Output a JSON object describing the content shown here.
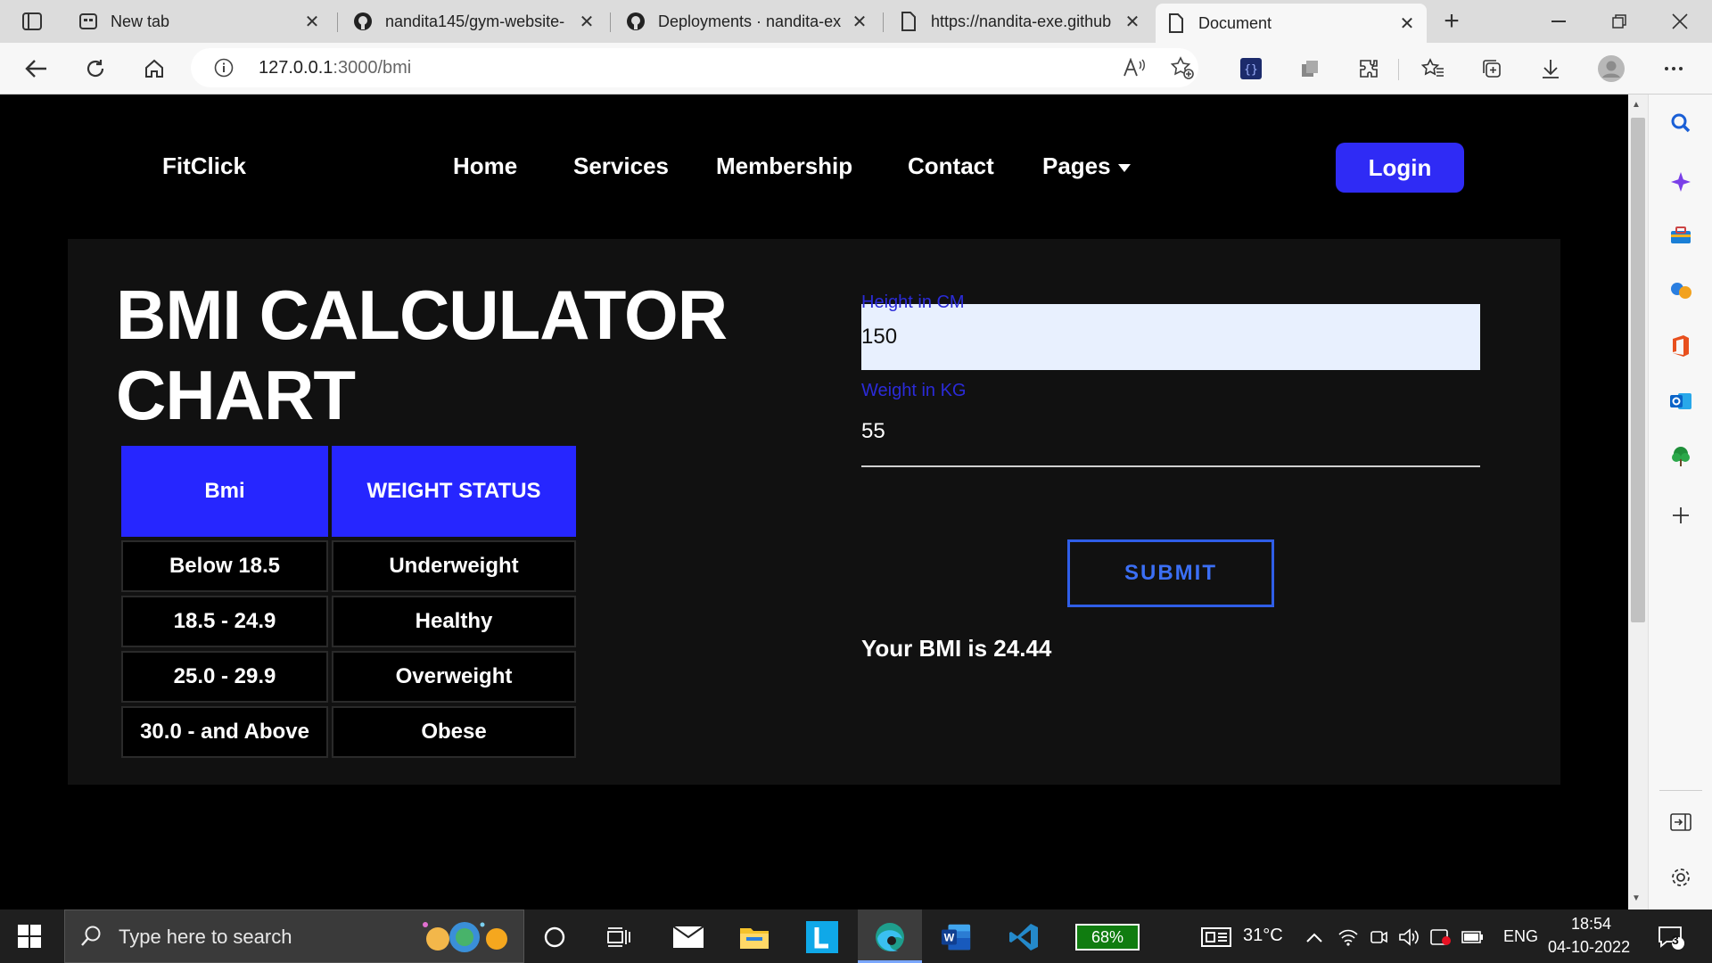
{
  "browser": {
    "tabs": [
      {
        "title": "New tab",
        "active": false
      },
      {
        "title": "nandita145/gym-website-",
        "active": false
      },
      {
        "title": "Deployments · nandita-ex",
        "active": false
      },
      {
        "title": "https://nandita-exe.github",
        "active": false
      },
      {
        "title": "Document",
        "active": true
      }
    ],
    "tab_close": "✕",
    "new_tab": "+",
    "url_host": "127.0.0.1",
    "url_path": ":3000/bmi"
  },
  "page": {
    "brand": "FitClick",
    "nav": {
      "home": "Home",
      "services": "Services",
      "membership": "Membership",
      "contact": "Contact",
      "pages": "Pages"
    },
    "login": "Login",
    "title_line1": "BMI CALCULATOR",
    "title_line2": "CHART",
    "table": {
      "headers": [
        "Bmi",
        "WEIGHT STATUS"
      ],
      "rows": [
        [
          "Below 18.5",
          "Underweight"
        ],
        [
          "18.5 - 24.9",
          "Healthy"
        ],
        [
          "25.0 - 29.9",
          "Overweight"
        ],
        [
          "30.0 - and Above",
          "Obese"
        ]
      ]
    },
    "form": {
      "height_label": "Height in CM",
      "height_value": "150",
      "weight_label": "Weight in KG",
      "weight_value": "55",
      "submit": "SUBMIT"
    },
    "result": "Your BMI is 24.44"
  },
  "taskbar": {
    "search_placeholder": "Type here to search",
    "battery": "68%",
    "weather": "31°C",
    "language": "ENG",
    "time": "18:54",
    "date": "04-10-2022",
    "notifications": "3"
  },
  "colors": {
    "accent": "#2f2bf5",
    "table_header": "#2626ff",
    "submit_border": "#2f5ee8",
    "panel": "#111111"
  }
}
